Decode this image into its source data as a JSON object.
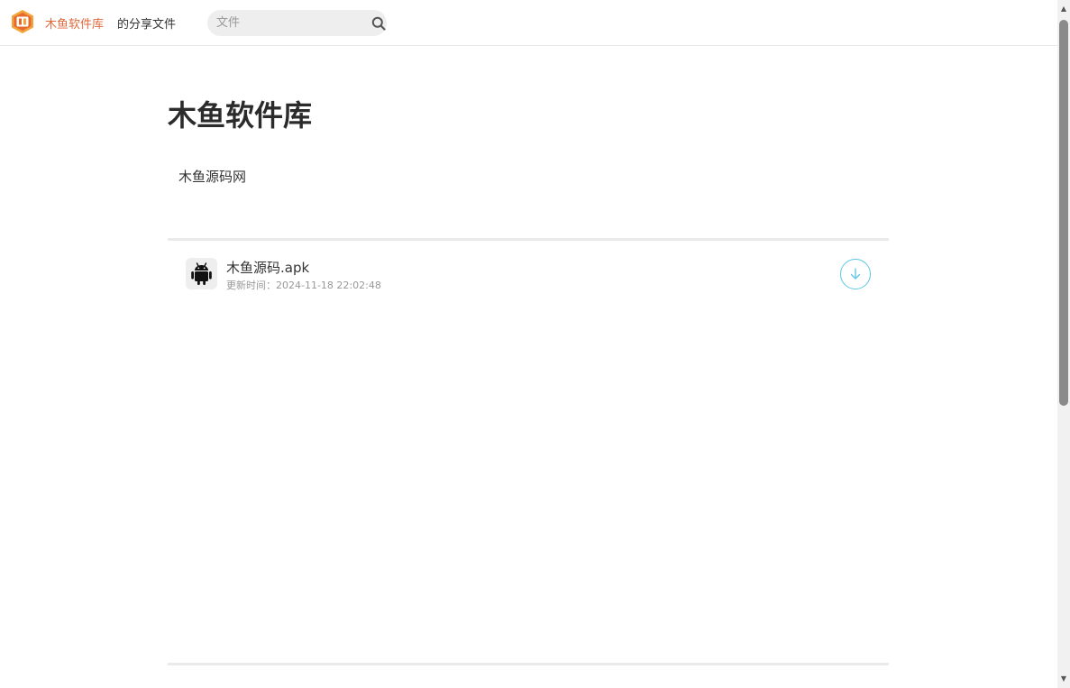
{
  "header": {
    "brand": "木鱼软件库",
    "brand_suffix": "的分享文件",
    "search": {
      "placeholder": "文件",
      "value": ""
    }
  },
  "main": {
    "title": "木鱼软件库",
    "description": "木鱼源码网",
    "files": [
      {
        "name": "木鱼源码.apk",
        "meta": "更新时间：2024-11-18 22:02:48",
        "icon": "android-icon"
      }
    ]
  },
  "colors": {
    "brand": "#e06a3c",
    "download_accent": "#5bc6e6",
    "scroll_thumb": "#8a8a8a"
  }
}
